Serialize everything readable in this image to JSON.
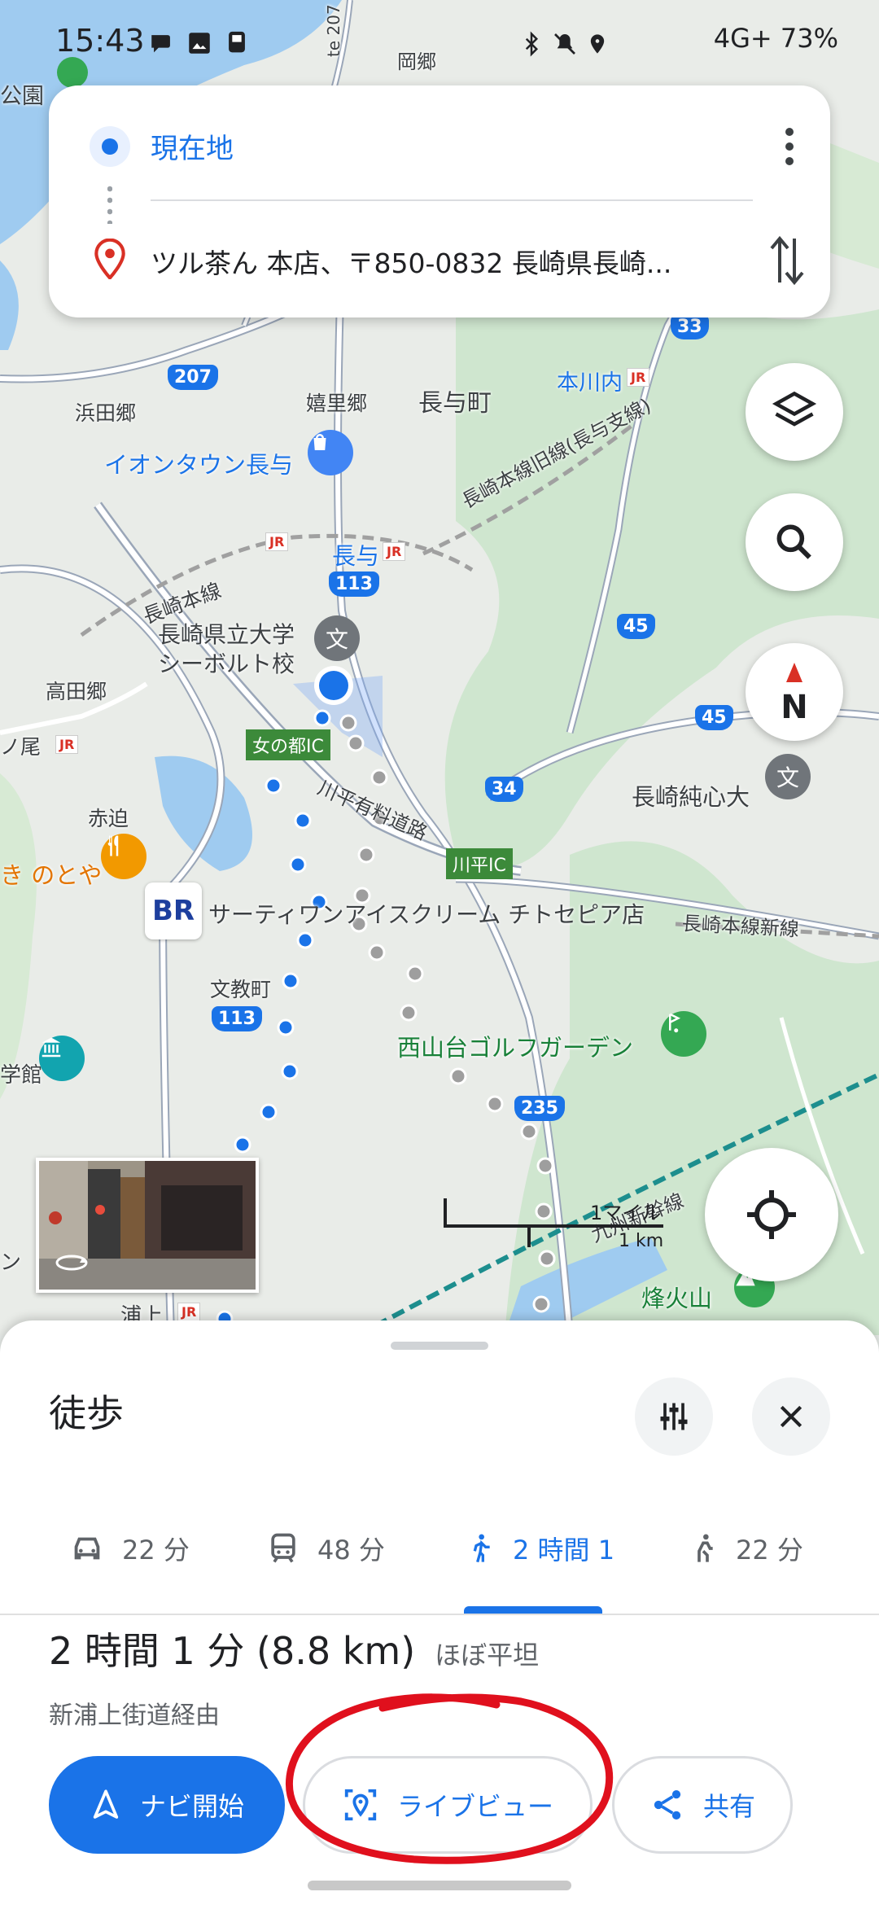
{
  "status_bar": {
    "time": "15:43",
    "right_text": "4G+ 73%"
  },
  "directions": {
    "origin": "現在地",
    "destination": "ツル茶ん 本店、〒850-0832 長崎県長崎..."
  },
  "map": {
    "place_labels": {
      "okaji": "岡郷",
      "park": "公園",
      "hamada": "浜田郷",
      "kairi": "嬉里郷",
      "nagayo_town": "長与町",
      "honkawauchi": "本川内",
      "aeon": "イオンタウン長与",
      "nagayo_station": "長与",
      "old_line": "長崎本線旧線(長与支線)",
      "main_line": "長崎本線",
      "university": "長崎県立大学\nシーボルト校",
      "takada": "高田郷",
      "no_o": "ノ尾",
      "akasako": "赤迫",
      "notoya": "き のとや",
      "baskin": "サーティワンアイスクリーム チトセピア店",
      "new_line": "長崎本線新線",
      "bunkyo": "文教町",
      "golf": "西山台ゴルフガーデン",
      "junshin": "長崎純心大",
      "kyushu_shinkansen": "九州新幹線",
      "hotarubi": "烽火山",
      "urakami": "浦上",
      "museum_partial": "学館",
      "partial_left": "ン",
      "expressway": "川平有料道路",
      "route207_vertical": "te 207"
    },
    "road_shields": [
      "207",
      "113",
      "45",
      "45",
      "34",
      "113",
      "235",
      "33"
    ],
    "ic_labels": [
      "女の都IC",
      "川平IC"
    ],
    "jr": "JR",
    "baskin_logo": "BR",
    "scale": {
      "imperial": "1マイル",
      "metric": "1 km"
    },
    "compass": "N"
  },
  "sheet": {
    "mode_title": "徒歩",
    "tabs": [
      {
        "label": "22 分",
        "icon": "car-icon"
      },
      {
        "label": "48 分",
        "icon": "transit-icon"
      },
      {
        "label": "2 時間 1",
        "icon": "walk-icon",
        "active": true
      },
      {
        "label": "22 分",
        "icon": "rideshare-icon"
      }
    ],
    "summary": "2 時間 1 分 (8.8 km)",
    "terrain": "ほぼ平坦",
    "via": "新浦上街道経由",
    "buttons": {
      "start": "ナビ開始",
      "live_view": "ライブビュー",
      "share": "共有"
    }
  },
  "colors": {
    "accent": "#1a73e8",
    "annotation": "#e0101d",
    "walk_dots": "#1a73e8",
    "alt_route_dots": "#9e9e9e"
  }
}
